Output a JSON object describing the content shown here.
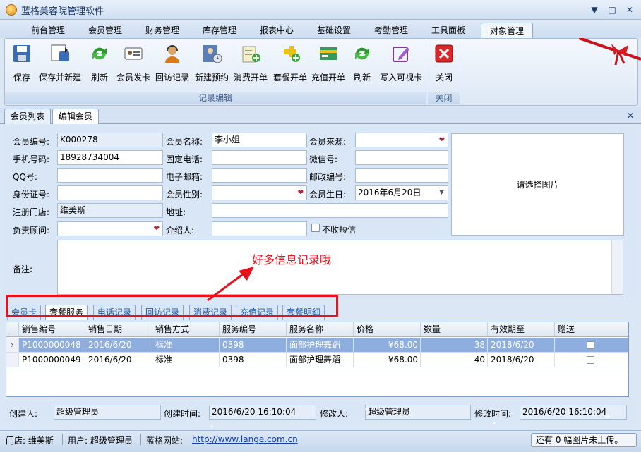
{
  "window": {
    "title": "蓝格美容院管理软件",
    "min": "▼",
    "max": "□",
    "close": "✕"
  },
  "menu_tabs": [
    "前台管理",
    "会员管理",
    "财务管理",
    "库存管理",
    "报表中心",
    "基础设置",
    "考勤管理",
    "工具面板",
    "对象管理"
  ],
  "ribbon": {
    "buttons": [
      "保存",
      "保存并新建",
      "刷新",
      "会员发卡",
      "回访记录",
      "新建预约",
      "消费开单",
      "套餐开单",
      "充值开单",
      "刷新",
      "写入可视卡"
    ],
    "group1_label": "记录编辑",
    "close_label": "关闭",
    "group2_label": "关闭"
  },
  "doc_tabs": [
    "会员列表",
    "编辑会员"
  ],
  "form": {
    "labels": {
      "member_no": "会员编号:",
      "member_name": "会员名称:",
      "member_source": "会员来源:",
      "mobile": "手机号码:",
      "phone": "固定电话:",
      "wechat": "微信号:",
      "qq": "QQ号:",
      "email": "电子邮箱:",
      "postcode": "邮政编号:",
      "id_card": "身份证号:",
      "gender": "会员性别:",
      "birthday": "会员生日:",
      "store": "注册门店:",
      "address": "地址:",
      "advisor": "负责顾问:",
      "referrer": "介绍人:",
      "no_sms": "不收短信",
      "note": "备注:"
    },
    "values": {
      "member_no": "K000278",
      "member_name": "李小姐",
      "mobile": "18928734004",
      "birthday": "2016年6月20日",
      "store": "维美斯"
    },
    "photo_placeholder": "请选择图片",
    "annotation": "好多信息记录哦"
  },
  "sub_tabs": [
    "会员卡",
    "套餐服务",
    "电话记录",
    "回访记录",
    "消费记录",
    "充值记录",
    "套餐明细"
  ],
  "grid": {
    "headers": [
      "销售编号",
      "销售日期",
      "销售方式",
      "服务编号",
      "服务名称",
      "价格",
      "数量",
      "有效期至",
      "赠送"
    ],
    "rows": [
      [
        "P1000000048",
        "2016/6/20",
        "标准",
        "0398",
        "面部护理舞蹈",
        "¥68.00",
        "38",
        "2018/6/20"
      ],
      [
        "P1000000049",
        "2016/6/20",
        "标准",
        "0398",
        "面部护理舞蹈",
        "¥68.00",
        "40",
        "2018/6/20"
      ]
    ]
  },
  "footer": {
    "creator_label": "创建人:",
    "creator": "超级管理员",
    "created_label": "创建时间:",
    "created": "2016/6/20 16:10:04",
    "modifier_label": "修改人:",
    "modifier": "超级管理员",
    "modified_label": "修改时间:",
    "modified": "2016/6/20 16:10:04"
  },
  "status": {
    "store": "门店: 维美斯",
    "user": "用户: 超级管理员",
    "site_label": "蓝格网站:",
    "site": "http://www.lange.com.cn",
    "upload": "还有 0 幅图片未上传。"
  }
}
